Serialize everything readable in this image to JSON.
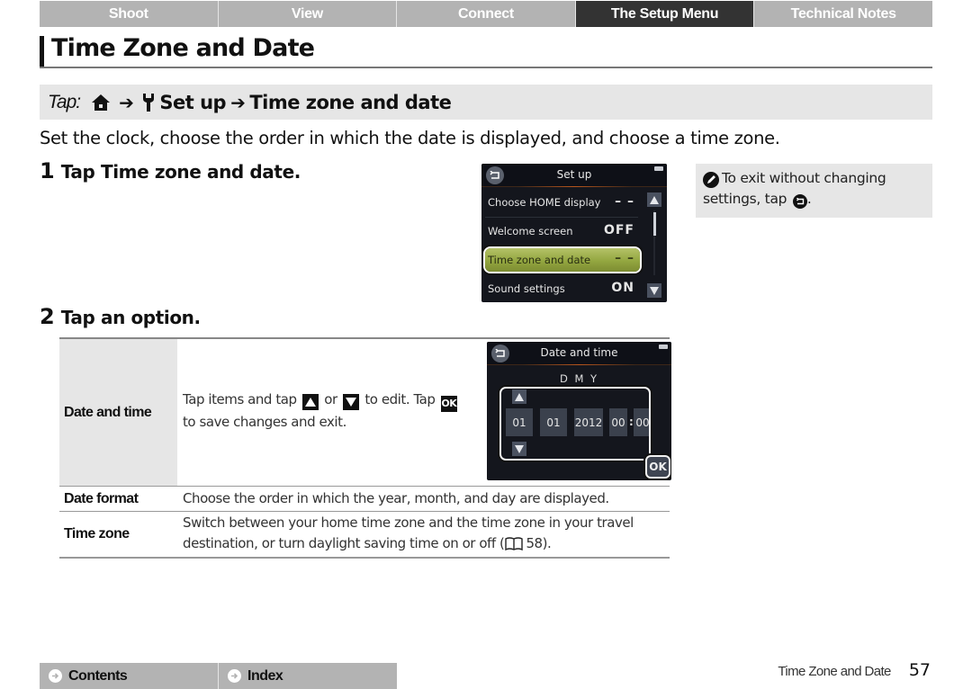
{
  "nav": {
    "tabs": [
      {
        "label": "Shoot",
        "active": false
      },
      {
        "label": "View",
        "active": false
      },
      {
        "label": "Connect",
        "active": false
      },
      {
        "label": "The Setup Menu",
        "active": true
      },
      {
        "label": "Technical Notes",
        "active": false
      }
    ]
  },
  "page_title": "Time Zone and Date",
  "tap_path": {
    "prefix": "Tap:",
    "icons": [
      "home-icon",
      "wrench-icon"
    ],
    "step1": "Set up",
    "step2": "Time zone and date",
    "arrow": "➔"
  },
  "intro": "Set the clock, choose the order in which the date is displayed, and choose a time zone.",
  "steps": [
    {
      "number": "1",
      "prefix": "Tap",
      "text": "Time zone and date."
    },
    {
      "number": "2",
      "prefix": "Tap",
      "text": "an option."
    }
  ],
  "setup_screen": {
    "title": "Set up",
    "items": [
      {
        "label": "Choose HOME display",
        "value": "– –",
        "selected": false
      },
      {
        "label": "Welcome screen",
        "value": "OFF",
        "selected": false
      },
      {
        "label": "Time zone and date",
        "value": "– –",
        "selected": true
      },
      {
        "label": "Sound settings",
        "value": "ON",
        "selected": false
      }
    ]
  },
  "note": {
    "text1": "To exit without changing settings, tap",
    "text2": "."
  },
  "options": [
    {
      "key": "Date and time",
      "desc_parts": [
        "Tap items and tap",
        "or",
        "to edit. Tap",
        "to save changes and exit."
      ],
      "ok_label": "OK",
      "screen": {
        "title": "Date and time",
        "format": "D M Y",
        "fields": [
          "01",
          "01",
          "2012",
          "00",
          "00"
        ],
        "colon": ":",
        "ok": "OK"
      }
    },
    {
      "key": "Date format",
      "desc": "Choose the order in which the year, month, and day are displayed."
    },
    {
      "key": "Time zone",
      "desc_before": "Switch between your home time zone and the time zone in your travel destination, or turn daylight saving time on or off (",
      "page_ref": "58",
      "desc_after": ")."
    }
  ],
  "footer": {
    "contents": "Contents",
    "index": "Index",
    "section": "Time Zone and Date",
    "page_number": "57"
  }
}
